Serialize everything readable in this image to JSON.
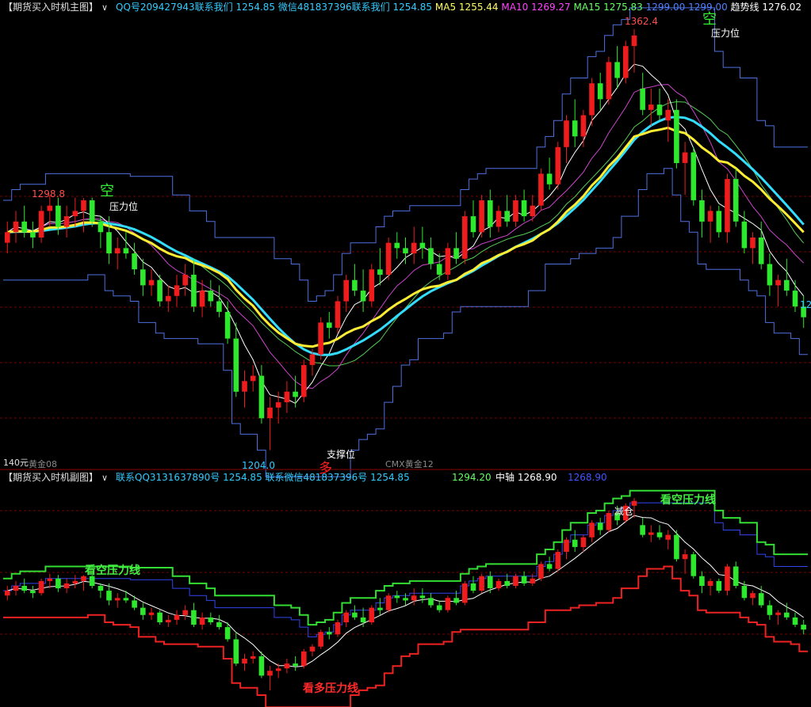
{
  "main_panel": {
    "title": "【期货买入时机主图】",
    "indicators": [
      {
        "label": "QQ号209427943联系我们",
        "value": "1254.85",
        "color": "#33ccff"
      },
      {
        "label": "微信481837396联系我们",
        "value": "1254.85",
        "color": "#33ccff"
      },
      {
        "label": "MA5",
        "value": "1255.44",
        "color": "#ffff66"
      },
      {
        "label": "MA10",
        "value": "1269.27",
        "color": "#ff44ff"
      },
      {
        "label": "MA15",
        "value": "1275.83",
        "color": "#66ff66"
      },
      {
        "label": "",
        "value": "1299.00",
        "color": "#4f80ff"
      },
      {
        "label": "",
        "value": "1299.00",
        "color": "#4f80ff"
      },
      {
        "label": "趋势线",
        "value": "1276.02",
        "color": "#ffffff"
      }
    ],
    "markers": {
      "peak_label": "1362.4",
      "high_label": "1298.8",
      "low_label": "1204.0",
      "right_label": "12",
      "kong_1": "空",
      "kong_2": "空",
      "duo": "多",
      "pressure_1": "压力位",
      "pressure_2": "压力位",
      "support": "支撑位",
      "bottom_left": "140元",
      "contract_1": "黄金08",
      "contract_2": "CMX黄金12"
    }
  },
  "sub_panel": {
    "title": "【期货买入时机副图】",
    "indicators": [
      {
        "label": "联系QQ3131637890号",
        "value": "1254.85",
        "color": "#33ccff"
      },
      {
        "label": "联系微信481837396号",
        "value": "1254.85",
        "color": "#33ccff"
      },
      {
        "label": "",
        "value": "1294.20",
        "color": "#66ff66"
      },
      {
        "label": "中轴",
        "value": "1268.90",
        "color": "#ffffff"
      },
      {
        "label": "",
        "value": "1268.90",
        "color": "#4455ff"
      }
    ],
    "markers": {
      "bear_line_1": "看空压力线",
      "bear_line_2": "看空压力线",
      "bull_line": "看多压力线",
      "reduce": "减仓"
    }
  },
  "chart_data": {
    "type": "candlestick",
    "y_range_main": [
      1200,
      1365
    ],
    "candles": [
      [
        1282,
        1290,
        1278,
        1286
      ],
      [
        1286,
        1294,
        1282,
        1290
      ],
      [
        1290,
        1296,
        1284,
        1286
      ],
      [
        1286,
        1290,
        1280,
        1284
      ],
      [
        1284,
        1296,
        1282,
        1294
      ],
      [
        1294,
        1300,
        1288,
        1296
      ],
      [
        1296,
        1299,
        1285,
        1288
      ],
      [
        1288,
        1296,
        1284,
        1292
      ],
      [
        1292,
        1299,
        1288,
        1294
      ],
      [
        1294,
        1298.8,
        1286,
        1298
      ],
      [
        1298,
        1299,
        1288,
        1290
      ],
      [
        1290,
        1292,
        1280,
        1286
      ],
      [
        1286,
        1292,
        1274,
        1278
      ],
      [
        1278,
        1284,
        1272,
        1280
      ],
      [
        1280,
        1286,
        1276,
        1278
      ],
      [
        1278,
        1282,
        1270,
        1272
      ],
      [
        1272,
        1276,
        1262,
        1266
      ],
      [
        1266,
        1272,
        1262,
        1268
      ],
      [
        1268,
        1270,
        1258,
        1260
      ],
      [
        1260,
        1266,
        1256,
        1262
      ],
      [
        1262,
        1270,
        1258,
        1266
      ],
      [
        1266,
        1274,
        1262,
        1270
      ],
      [
        1270,
        1276,
        1256,
        1258
      ],
      [
        1258,
        1268,
        1254,
        1264
      ],
      [
        1264,
        1268,
        1258,
        1260
      ],
      [
        1260,
        1266,
        1254,
        1256
      ],
      [
        1256,
        1260,
        1244,
        1246
      ],
      [
        1246,
        1252,
        1224,
        1226
      ],
      [
        1226,
        1234,
        1220,
        1230
      ],
      [
        1230,
        1236,
        1226,
        1232
      ],
      [
        1232,
        1236,
        1214,
        1216
      ],
      [
        1216,
        1224,
        1204,
        1220
      ],
      [
        1220,
        1226,
        1214,
        1222
      ],
      [
        1222,
        1230,
        1218,
        1226
      ],
      [
        1226,
        1232,
        1220,
        1224
      ],
      [
        1224,
        1238,
        1222,
        1236
      ],
      [
        1236,
        1242,
        1232,
        1240
      ],
      [
        1240,
        1254,
        1238,
        1252
      ],
      [
        1252,
        1256,
        1246,
        1250
      ],
      [
        1250,
        1262,
        1248,
        1260
      ],
      [
        1260,
        1270,
        1256,
        1268
      ],
      [
        1268,
        1274,
        1262,
        1264
      ],
      [
        1264,
        1272,
        1256,
        1260
      ],
      [
        1260,
        1274,
        1258,
        1272
      ],
      [
        1272,
        1280,
        1266,
        1270
      ],
      [
        1270,
        1284,
        1268,
        1282
      ],
      [
        1282,
        1286,
        1276,
        1280
      ],
      [
        1280,
        1284,
        1274,
        1278
      ],
      [
        1278,
        1288,
        1274,
        1282
      ],
      [
        1282,
        1288,
        1276,
        1280
      ],
      [
        1280,
        1284,
        1272,
        1274
      ],
      [
        1274,
        1278,
        1268,
        1270
      ],
      [
        1270,
        1282,
        1268,
        1280
      ],
      [
        1280,
        1286,
        1274,
        1276
      ],
      [
        1276,
        1294,
        1274,
        1292
      ],
      [
        1292,
        1298,
        1284,
        1286
      ],
      [
        1286,
        1300,
        1284,
        1298
      ],
      [
        1298,
        1302,
        1284,
        1288
      ],
      [
        1288,
        1296,
        1286,
        1294
      ],
      [
        1294,
        1300,
        1288,
        1290
      ],
      [
        1290,
        1300,
        1288,
        1298
      ],
      [
        1298,
        1302,
        1290,
        1292
      ],
      [
        1292,
        1300,
        1290,
        1296
      ],
      [
        1296,
        1310,
        1294,
        1308
      ],
      [
        1308,
        1314,
        1302,
        1304
      ],
      [
        1304,
        1320,
        1302,
        1318
      ],
      [
        1318,
        1330,
        1312,
        1328
      ],
      [
        1328,
        1336,
        1318,
        1322
      ],
      [
        1322,
        1332,
        1318,
        1330
      ],
      [
        1330,
        1344,
        1326,
        1342
      ],
      [
        1342,
        1346,
        1332,
        1336
      ],
      [
        1336,
        1352,
        1334,
        1350
      ],
      [
        1350,
        1356,
        1340,
        1344
      ],
      [
        1344,
        1358,
        1342,
        1356
      ],
      [
        1356,
        1362.4,
        1346,
        1360
      ],
      [
        1340,
        1346,
        1330,
        1332
      ],
      [
        1332,
        1340,
        1326,
        1334
      ],
      [
        1334,
        1340,
        1328,
        1330
      ],
      [
        1328,
        1336,
        1320,
        1332
      ],
      [
        1332,
        1336,
        1310,
        1312
      ],
      [
        1312,
        1320,
        1300,
        1316
      ],
      [
        1316,
        1318,
        1296,
        1298
      ],
      [
        1298,
        1302,
        1284,
        1290
      ],
      [
        1290,
        1296,
        1282,
        1294
      ],
      [
        1294,
        1296,
        1284,
        1286
      ],
      [
        1286,
        1308,
        1282,
        1306
      ],
      [
        1306,
        1310,
        1288,
        1290
      ],
      [
        1290,
        1294,
        1278,
        1280
      ],
      [
        1280,
        1286,
        1274,
        1284
      ],
      [
        1284,
        1290,
        1272,
        1274
      ],
      [
        1274,
        1278,
        1262,
        1266
      ],
      [
        1266,
        1270,
        1258,
        1268
      ],
      [
        1268,
        1276,
        1262,
        1264
      ],
      [
        1264,
        1268,
        1256,
        1258
      ],
      [
        1258,
        1262,
        1250,
        1254
      ]
    ]
  }
}
